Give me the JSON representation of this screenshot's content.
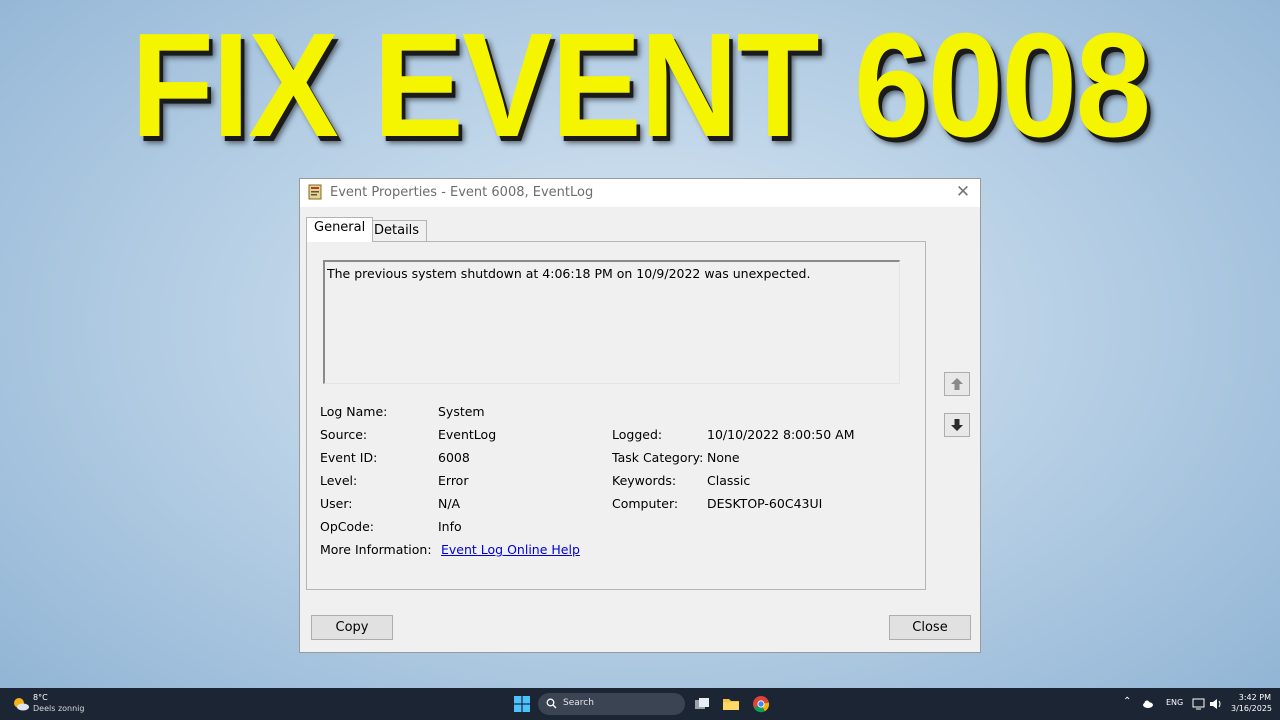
{
  "headline": "FIX EVENT 6008",
  "dialog": {
    "title": "Event Properties - Event 6008, EventLog",
    "tabs": [
      "General",
      "Details"
    ],
    "description": "The previous system shutdown at 4:06:18 PM on 10/9/2022 was unexpected.",
    "fields_left": [
      {
        "label": "Log Name:",
        "value": "System"
      },
      {
        "label": "Source:",
        "value": "EventLog"
      },
      {
        "label": "Event ID:",
        "value": "6008"
      },
      {
        "label": "Level:",
        "value": "Error"
      },
      {
        "label": "User:",
        "value": "N/A"
      },
      {
        "label": "OpCode:",
        "value": "Info"
      },
      {
        "label": "More Information:",
        "value": "Event Log Online Help"
      }
    ],
    "fields_right": [
      {
        "label": "Logged:",
        "value": "10/10/2022 8:00:50 AM"
      },
      {
        "label": "Task Category:",
        "value": "None"
      },
      {
        "label": "Keywords:",
        "value": "Classic"
      },
      {
        "label": "Computer:",
        "value": "DESKTOP-60C43UI"
      }
    ],
    "copy_label": "Copy",
    "close_label": "Close"
  },
  "taskbar": {
    "weather_temp": "8°C",
    "weather_desc": "Deels zonnig",
    "search_placeholder": "Search",
    "language": "ENG",
    "time": "3:42 PM",
    "date": "3/16/2025"
  },
  "colors": {
    "headline": "#f5f500",
    "link": "#0000d8",
    "taskbar": "#1b2533"
  },
  "icons": [
    "event-properties-icon",
    "close-icon",
    "up-arrow-icon",
    "down-arrow-icon",
    "weather-icon",
    "windows-start-icon",
    "search-icon",
    "task-view-icon",
    "file-explorer-icon",
    "chrome-icon",
    "chevron-up-icon",
    "cloud-icon",
    "network-icon",
    "volume-icon"
  ]
}
